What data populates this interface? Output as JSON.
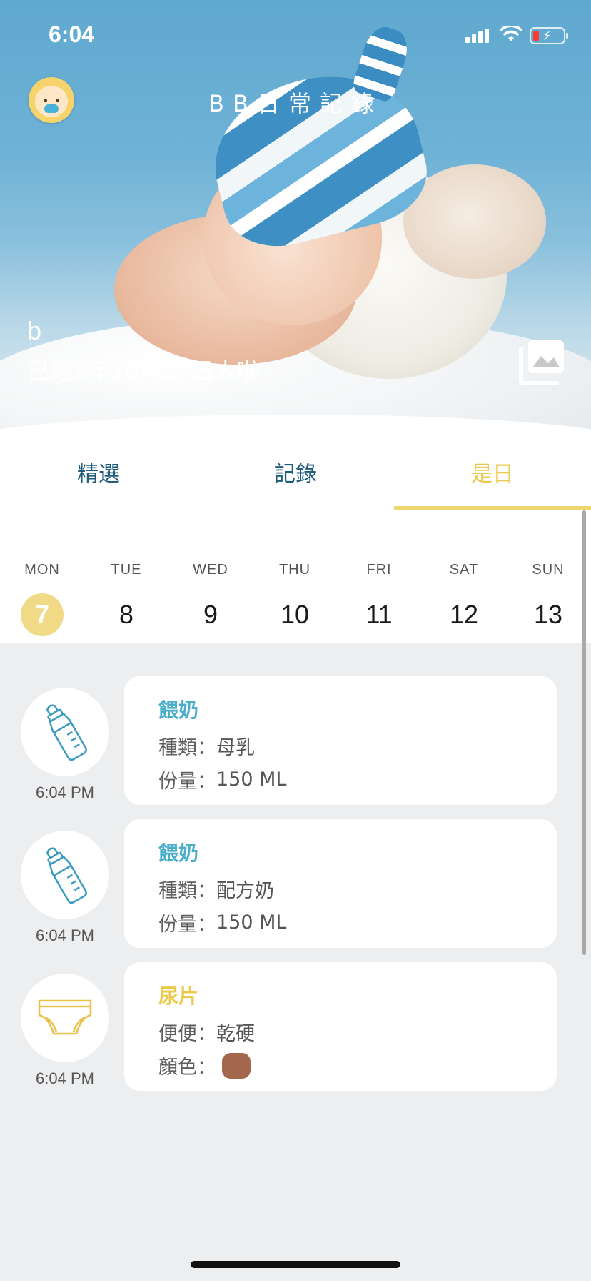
{
  "status_bar": {
    "time": "6:04"
  },
  "header": {
    "title": "BB日常記錄",
    "baby_name": "b",
    "baby_age": "已經2年10月27日大啦"
  },
  "tabs": [
    {
      "label": "精選",
      "active": false
    },
    {
      "label": "記錄",
      "active": false
    },
    {
      "label": "是日",
      "active": true
    }
  ],
  "week": {
    "days": [
      {
        "dow": "MON",
        "num": "7",
        "selected": true
      },
      {
        "dow": "TUE",
        "num": "8",
        "selected": false
      },
      {
        "dow": "WED",
        "num": "9",
        "selected": false
      },
      {
        "dow": "THU",
        "num": "10",
        "selected": false
      },
      {
        "dow": "FRI",
        "num": "11",
        "selected": false
      },
      {
        "dow": "SAT",
        "num": "12",
        "selected": false
      },
      {
        "dow": "SUN",
        "num": "13",
        "selected": false
      }
    ]
  },
  "records": [
    {
      "type": "feeding",
      "icon": "bottle-icon",
      "time": "6:04 PM",
      "title": "餵奶",
      "title_color": "#4aaecb",
      "line1": {
        "label": "種類：",
        "value": "母乳"
      },
      "line2": {
        "label": "份量：",
        "value": "150 ML"
      }
    },
    {
      "type": "feeding",
      "icon": "bottle-icon",
      "time": "6:04 PM",
      "title": "餵奶",
      "title_color": "#4aaecb",
      "line1": {
        "label": "種類：",
        "value": "配方奶"
      },
      "line2": {
        "label": "份量：",
        "value": "150 ML"
      }
    },
    {
      "type": "diaper",
      "icon": "diaper-icon",
      "time": "6:04 PM",
      "title": "尿片",
      "title_color": "#ecc94b",
      "line1": {
        "label": "便便：",
        "value": "乾硬"
      },
      "line2": {
        "label": "顏色：",
        "value": "",
        "swatch": "#a4674d"
      }
    }
  ],
  "colors": {
    "accent_yellow": "#ecd66d",
    "tab_text": "#1e5a7a",
    "feeding_blue": "#4aaecb"
  }
}
